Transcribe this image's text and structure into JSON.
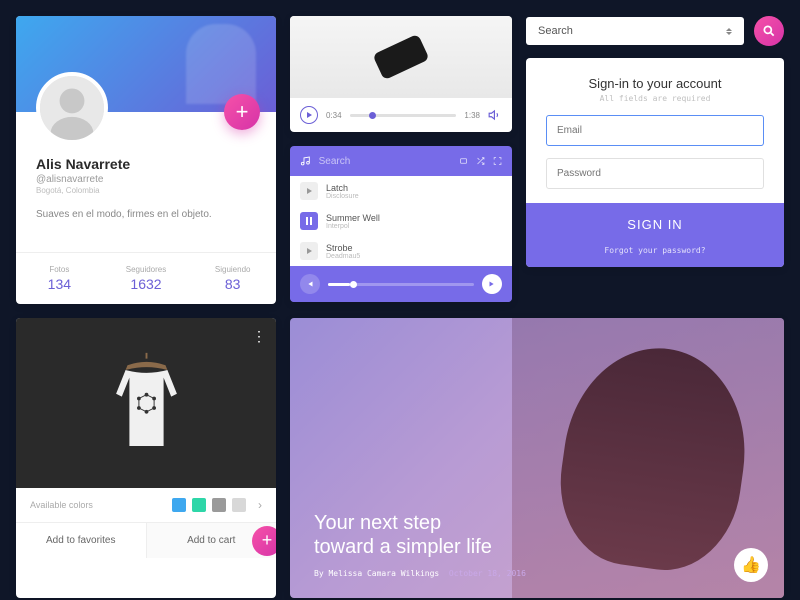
{
  "profile": {
    "name": "Alis Navarrete",
    "handle": "@alisnavarrete",
    "location": "Bogotá, Colombia",
    "bio": "Suaves en el modo, firmes en el objeto.",
    "stats": [
      {
        "label": "Fotos",
        "value": "134"
      },
      {
        "label": "Seguidores",
        "value": "1632"
      },
      {
        "label": "Siguiendo",
        "value": "83"
      }
    ]
  },
  "video": {
    "current_time": "0:34",
    "duration": "1:38"
  },
  "music": {
    "search_placeholder": "Search",
    "tracks": [
      {
        "title": "Latch",
        "artist": "Disclosure",
        "state": "play"
      },
      {
        "title": "Summer Well",
        "artist": "Interpol",
        "state": "pause"
      },
      {
        "title": "Strobe",
        "artist": "Deadmau5",
        "state": "play"
      }
    ]
  },
  "search": {
    "label": "Search"
  },
  "signin": {
    "title": "Sign-in to your account",
    "subtitle": "All fields are required",
    "email_placeholder": "Email",
    "password_placeholder": "Password",
    "button": "SIGN IN",
    "forgot": "Forgot your password?"
  },
  "product": {
    "colors_label": "Available colors",
    "colors": [
      "#3ea8ef",
      "#2ed6a8",
      "#9a9a9a",
      "#d8d8d8"
    ],
    "fav_label": "Add to favorites",
    "cart_label": "Add to cart"
  },
  "article": {
    "title_line1": "Your next step",
    "title_line2": "toward a simpler life",
    "by": "By ",
    "author": "Melissa Camara Wilkings",
    "date": "October 18, 2016"
  }
}
